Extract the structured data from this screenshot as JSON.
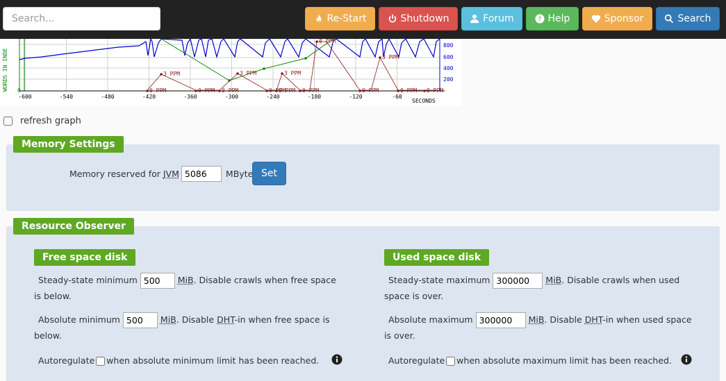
{
  "navbar": {
    "search_placeholder": "Search...",
    "buttons": {
      "restart": "Re-Start",
      "shutdown": "Shutdown",
      "forum": "Forum",
      "help": "Help",
      "sponsor": "Sponsor",
      "search": "Search"
    }
  },
  "graph": {
    "y_label": "WORDS IN INDE",
    "x_unit": "SECONDS",
    "x_ticks": [
      "-600",
      "-540",
      "-480",
      "-420",
      "-360",
      "-300",
      "-240",
      "-180",
      "-120",
      "-60"
    ],
    "right_ticks": [
      "800",
      "600",
      "400",
      "200"
    ],
    "left_zero": "0",
    "ppm_labels": [
      {
        "text": "0 PPM"
      },
      {
        "text": "3 PPM"
      },
      {
        "text": "0 PPM"
      },
      {
        "text": "0 PPM"
      },
      {
        "text": "3 PPM"
      },
      {
        "text": "0 PPM"
      },
      {
        "text": "3 PPM"
      },
      {
        "text": "0 PPM"
      },
      {
        "text": "0 PPM"
      },
      {
        "text": "0 PPM"
      },
      {
        "text": "3 PPM"
      },
      {
        "text": "0 PPM"
      },
      {
        "text": "0 PPM"
      },
      {
        "text": "0 PPM"
      }
    ],
    "colors": {
      "words_line": "#0000cc",
      "ppm_line": "#8b1a1a",
      "green_line": "#0a8a0a"
    }
  },
  "refresh": {
    "label": "refresh graph",
    "checked": false
  },
  "memory": {
    "legend": "Memory Settings",
    "label_prefix": "Memory reserved for",
    "label_abbr": "JVM",
    "value": "5086",
    "unit": "MByte",
    "set_label": "Set"
  },
  "resource": {
    "legend": "Resource Observer",
    "free": {
      "legend": "Free space disk",
      "steady_prefix": "Steady-state minimum",
      "steady_value": "500",
      "steady_unit": "MiB",
      "steady_suffix": ". Disable crawls when free space is below.",
      "abs_prefix": "Absolute minimum",
      "abs_value": "500",
      "abs_unit": "MiB",
      "abs_mid": ". Disable",
      "abs_abbr": "DHT",
      "abs_suffix": "-in when free space is below.",
      "auto_prefix": "Autoregulate",
      "auto_suffix": "when absolute minimum limit has been reached."
    },
    "used": {
      "legend": "Used space disk",
      "steady_prefix": "Steady-state maximum",
      "steady_value": "300000",
      "steady_unit": "MiB",
      "steady_suffix": ". Disable crawls when used space is over.",
      "abs_prefix": "Absolute maximum",
      "abs_value": "300000",
      "abs_unit": "MiB",
      "abs_mid": ". Disable",
      "abs_abbr": "DHT",
      "abs_suffix": "-in when used space is over.",
      "auto_prefix": "Autoregulate",
      "auto_suffix": "when absolute maximum limit has been reached."
    }
  }
}
